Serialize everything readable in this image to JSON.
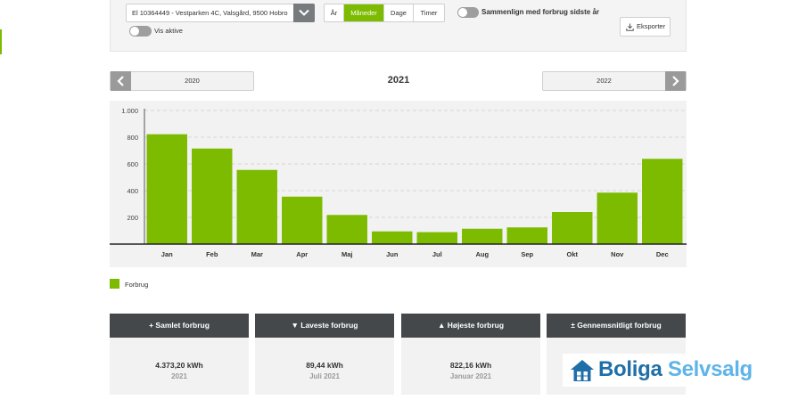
{
  "filters": {
    "meter_value": "El 10364449 - Vestparken 4C, Valsgård, 9500 Hobro",
    "show_active_label": "Vis aktive",
    "periods": [
      "År",
      "Måneder",
      "Dage",
      "Timer"
    ],
    "active_period": "Måneder",
    "compare_label": "Sammenlign med forbrug sidste år",
    "export_label": "Eksporter"
  },
  "year_nav": {
    "previous": "2020",
    "current": "2021",
    "next": "2022"
  },
  "colors": {
    "accent": "#7dbb00",
    "header_dark": "#45484b",
    "chart_bg": "#f2f2f2"
  },
  "chart_data": {
    "type": "bar",
    "categories": [
      "Jan",
      "Feb",
      "Mar",
      "Apr",
      "Maj",
      "Jun",
      "Jul",
      "Aug",
      "Sep",
      "Okt",
      "Nov",
      "Dec"
    ],
    "series": [
      {
        "name": "Forbrug",
        "values": [
          822,
          715,
          555,
          355,
          218,
          95,
          89.44,
          115,
          125,
          240,
          385,
          638
        ]
      }
    ],
    "y_ticks": [
      "1.000",
      "800",
      "600",
      "400",
      "200"
    ],
    "ylim": [
      0,
      1000
    ],
    "grid": true,
    "legend_position": "bottom-left"
  },
  "legend": {
    "label": "Forbrug"
  },
  "stats": [
    {
      "icon": "plus-minus-none",
      "title": "+ Samlet forbrug",
      "value": "4.373,20 kWh",
      "sub": "2021"
    },
    {
      "icon": "down-triangle",
      "title": "▼ Laveste forbrug",
      "value": "89,44 kWh",
      "sub": "Juli 2021"
    },
    {
      "icon": "up-triangle",
      "title": "▲ Højeste forbrug",
      "value": "822,16 kWh",
      "sub": "Januar 2021"
    },
    {
      "icon": "plus-minus",
      "title": "± Gennemsnitligt forbrug",
      "value": "",
      "sub": ""
    }
  ],
  "watermark": {
    "part1": "Boliga",
    "part2": "Selvsalg"
  }
}
